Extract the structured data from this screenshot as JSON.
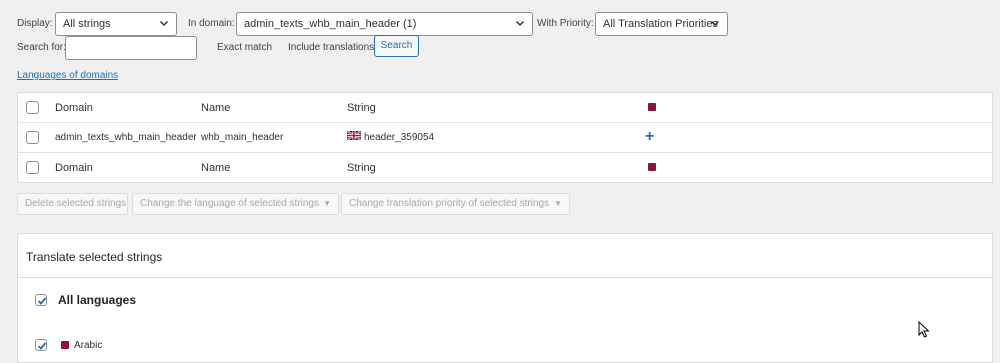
{
  "filters": {
    "display_label": "Display:",
    "display_value": "All strings",
    "domain_label": "In domain:",
    "domain_value": "admin_texts_whb_main_header (1)",
    "priority_label": "With Priority:",
    "priority_value": "All Translation Priorities",
    "search_label": "Search for:",
    "search_value": "",
    "exact_match_label": "Exact match",
    "include_translations_label": "Include translations",
    "search_button": "Search"
  },
  "languages_of_domains_link": "Languages of domains",
  "table": {
    "header": {
      "domain": "Domain",
      "name": "Name",
      "string": "String"
    },
    "rows": [
      {
        "domain": "admin_texts_whb_main_header",
        "name": "whb_main_header",
        "string": "header_359054",
        "string_flag": "uk-flag-icon",
        "action": "+"
      }
    ],
    "footer": {
      "domain": "Domain",
      "name": "Name",
      "string": "String"
    },
    "language_flag": "qatar-flag-icon"
  },
  "bulk_actions": {
    "delete": "Delete selected strings",
    "change_language": "Change the language of selected strings",
    "change_priority": "Change translation priority of selected strings"
  },
  "translate_panel": {
    "title": "Translate selected strings",
    "all_languages": "All languages",
    "all_languages_checked": true,
    "languages": [
      {
        "name": "Arabic",
        "checked": true,
        "flag": "qatar-flag-icon"
      }
    ]
  },
  "colors": {
    "background": "#f0f0f1",
    "accent": "#2271b1",
    "flag_maroon": "#8a1538"
  }
}
